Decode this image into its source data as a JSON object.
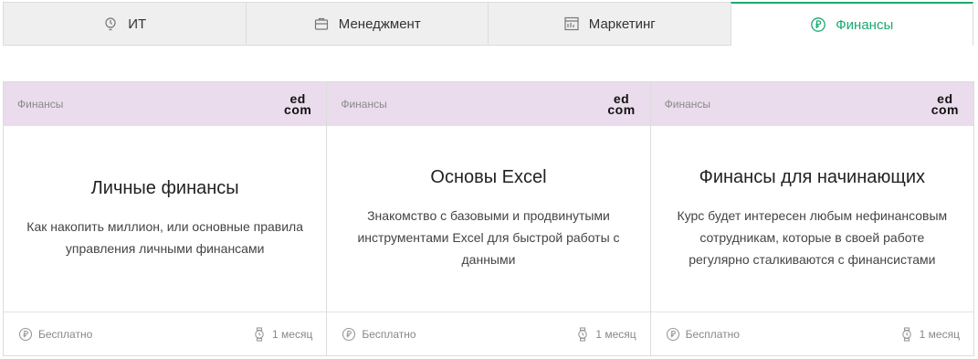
{
  "tabs": [
    {
      "label": "ИТ",
      "icon": "lightbulb-icon"
    },
    {
      "label": "Менеджмент",
      "icon": "briefcase-icon"
    },
    {
      "label": "Маркетинг",
      "icon": "chart-board-icon"
    },
    {
      "label": "Финансы",
      "icon": "ruble-icon",
      "active": true
    }
  ],
  "accent_color": "#1aa971",
  "card_header_color": "#eadcec",
  "cards": [
    {
      "category": "Финансы",
      "logo_top": "ed",
      "logo_bottom": "com",
      "title": "Личные финансы",
      "description": "Как накопить миллион, или основные правила управления личными финансами",
      "price": "Бесплатно",
      "duration": "1 месяц"
    },
    {
      "category": "Финансы",
      "logo_top": "ed",
      "logo_bottom": "com",
      "title": "Основы Excel",
      "description": "Знакомство с базовыми и продвинутыми инструментами Excel для быстрой работы с данными",
      "price": "Бесплатно",
      "duration": "1 месяц"
    },
    {
      "category": "Финансы",
      "logo_top": "ed",
      "logo_bottom": "com",
      "title": "Финансы для начинающих",
      "description": "Курс будет интересен любым нефинансовым сотрудникам, которые в своей работе регулярно сталкиваются с финансистами",
      "price": "Бесплатно",
      "duration": "1 месяц"
    }
  ]
}
